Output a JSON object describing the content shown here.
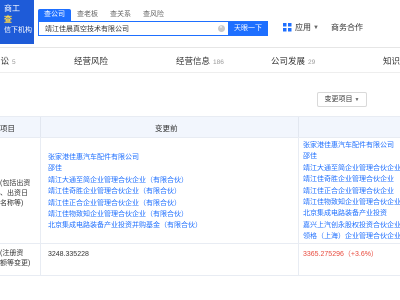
{
  "logo": {
    "line1": "商工",
    "line2": "查",
    "line3": "信下机构"
  },
  "search": {
    "tabs": [
      {
        "label": "查公司",
        "active": true
      },
      {
        "label": "查老板",
        "active": false
      },
      {
        "label": "查关系",
        "active": false
      },
      {
        "label": "查风险",
        "active": false
      }
    ],
    "value": "靖江佳晨真空技术有限公司",
    "button_label": "天眼一下"
  },
  "top_right": {
    "apps_label": "应用",
    "business_label": "商务合作"
  },
  "nav": {
    "items": [
      {
        "label": "诉讼",
        "count": "5"
      },
      {
        "label": "经营风险",
        "count": ""
      },
      {
        "label": "经营信息",
        "count": "186"
      },
      {
        "label": "公司发展",
        "count": "29"
      },
      {
        "label": "知识",
        "count": ""
      }
    ]
  },
  "filter": {
    "label": "变更项目"
  },
  "table": {
    "headers": {
      "item": "项目",
      "before": "变更前"
    },
    "rows": [
      {
        "item_lines": [
          "(包括出资",
          "、出资日",
          "名称等)"
        ],
        "before": [
          "张家港佳惠汽车配件有限公司",
          "邵佳",
          "靖江大通至简企业管理合伙企业（有限合伙）",
          "靖江佳奇胜企业管理合伙企业（有限合伙）",
          "靖江佳正合企业管理合伙企业（有限合伙）",
          "靖江佳物致知企业管理合伙企业（有限合伙）",
          "北京集成电路装备产业投资并购基金（有限合伙）"
        ],
        "after": [
          "张家港佳惠汽车配件有限公司",
          "邵佳",
          "靖江大通至简企业管理合伙企业",
          "靖江佳奇胜企业管理合伙企业",
          "靖江佳正合企业管理合伙企业",
          "靖江佳物致知企业管理合伙企业",
          "北京集成电路装备产业投资",
          "嘉兴上汽创永股权投资合伙企业",
          "领格（上海）企业管理合伙企业"
        ]
      },
      {
        "item_lines": [
          "(注册资",
          "额等变更)"
        ],
        "before_value": "3248.335228",
        "after_value": "3365.275296",
        "after_change": "（+3.6%）"
      }
    ]
  },
  "colors": {
    "brand_blue": "#1e6fff",
    "logo_blue": "#1e5bd8",
    "header_bg": "#f2f6fd",
    "increase_red": "#e84a3d"
  }
}
